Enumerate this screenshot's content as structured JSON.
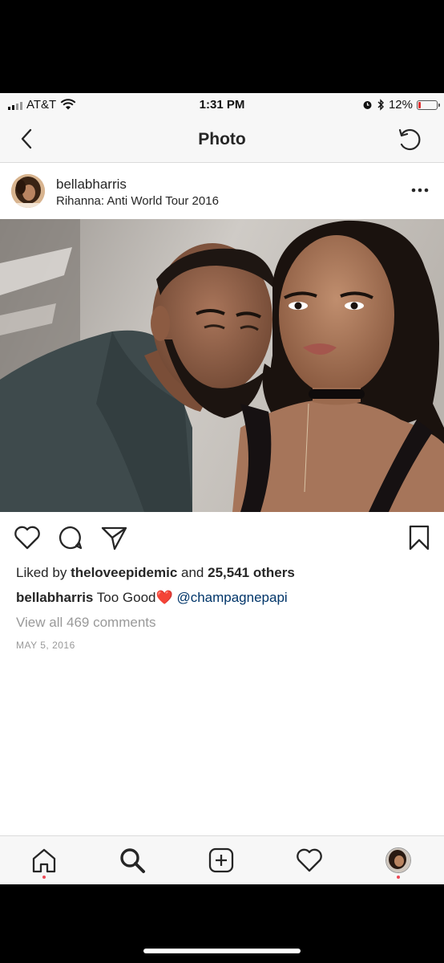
{
  "status_bar": {
    "carrier": "AT&T",
    "time": "1:31 PM",
    "battery": "12%",
    "battery_level": 0.12,
    "battery_color": "#e03030"
  },
  "nav": {
    "title": "Photo",
    "back_icon": "chevron-left-icon",
    "refresh_icon": "refresh-icon"
  },
  "post": {
    "username": "bellabharris",
    "location": "Rihanna: Anti World Tour 2016",
    "liked_by_prefix": "Liked by",
    "liked_by_user": "theloveepidemic",
    "liked_by_and": "and",
    "liked_by_others": "25,541 others",
    "caption_user": "bellabharris",
    "caption_text": "Too Good",
    "caption_emoji": "❤️",
    "caption_mention": "@champagnepapi",
    "view_comments": "View all 469 comments",
    "date": "MAY 5, 2016",
    "mention_color": "#003569"
  },
  "tabbar": {
    "items": [
      "home-icon",
      "search-icon",
      "add-icon",
      "heart-icon",
      "profile-avatar"
    ],
    "notification_color": "#ed4956"
  }
}
